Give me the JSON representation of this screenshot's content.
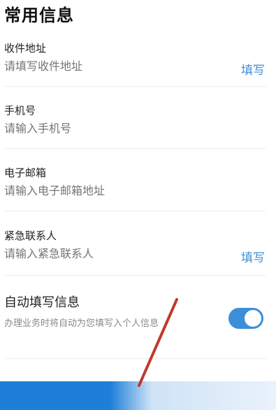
{
  "page": {
    "title": "常用信息"
  },
  "fields": [
    {
      "label": "收件地址",
      "placeholder": "请填写收件地址",
      "action": "填写"
    },
    {
      "label": "手机号",
      "placeholder": "请输入手机号"
    },
    {
      "label": "电子邮箱",
      "placeholder": "请输入电子邮箱地址"
    },
    {
      "label": "紧急联系人",
      "placeholder": "请输入紧急联系人",
      "action": "填写"
    }
  ],
  "auto_fill": {
    "title": "自动填写信息",
    "description": "办理业务时将自动为您填写入个人信息",
    "enabled": true
  },
  "colors": {
    "accent": "#3d8ed8",
    "placeholder": "#c9ccd1",
    "annotation": "#c0392b"
  }
}
